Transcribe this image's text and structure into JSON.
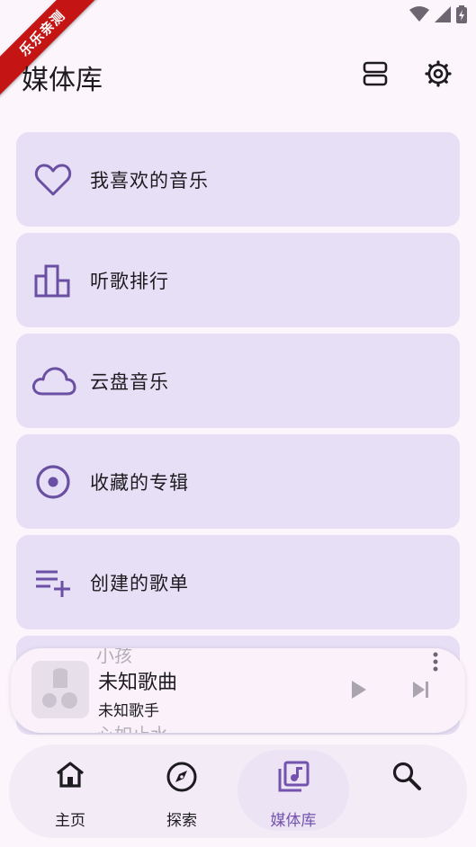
{
  "status_bar": {
    "icons": [
      "wifi-icon",
      "signal-icon",
      "battery-icon"
    ]
  },
  "watermark": {
    "text": "乐乐亲测"
  },
  "header": {
    "title": "媒体库",
    "actions": [
      {
        "icon": "view-toggle-icon"
      },
      {
        "icon": "settings-gear-icon"
      }
    ]
  },
  "library": {
    "items": [
      {
        "label": "我喜欢的音乐",
        "icon": "heart-icon"
      },
      {
        "label": "听歌排行",
        "icon": "bar-chart-icon"
      },
      {
        "label": "云盘音乐",
        "icon": "cloud-icon"
      },
      {
        "label": "收藏的专辑",
        "icon": "album-disc-icon"
      },
      {
        "label": "创建的歌单",
        "icon": "playlist-add-icon"
      }
    ]
  },
  "player": {
    "song_title": "未知歌曲",
    "artist": "未知歌手",
    "lyric_prev": "小孩",
    "lyric_main": "",
    "lyric_next": "心如止水",
    "accent_color": "#7353ad"
  },
  "nav": {
    "items": [
      {
        "label": "主页",
        "icon": "home-icon",
        "active": false
      },
      {
        "label": "探索",
        "icon": "compass-icon",
        "active": false
      },
      {
        "label": "媒体库",
        "icon": "library-music-icon",
        "active": true
      },
      {
        "label": "",
        "icon": "search-icon",
        "active": false
      }
    ],
    "active_color": "#7353ad"
  }
}
